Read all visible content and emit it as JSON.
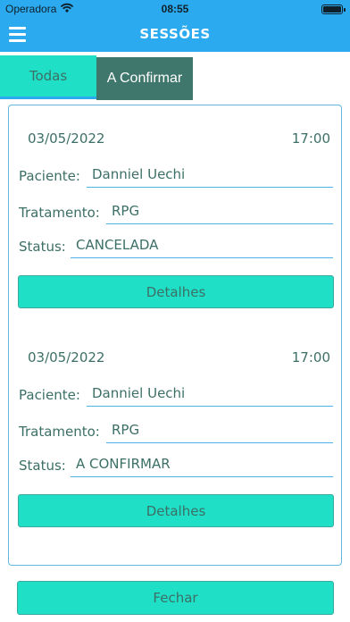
{
  "status_bar": {
    "carrier": "Operadora",
    "time": "08:55",
    "wifi_icon": "wifi-icon",
    "battery_icon": "battery-icon",
    "battery_level": 1.0
  },
  "header": {
    "title": "SESSÕES",
    "menu_icon": "menu-icon"
  },
  "tabs": [
    {
      "label": "Todas",
      "selected": true
    },
    {
      "label": "A Confirmar",
      "selected": false
    }
  ],
  "sessions": [
    {
      "date": "03/05/2022",
      "time": "17:00",
      "patient_label": "Paciente:",
      "patient": "Danniel Uechi",
      "treatment_label": "Tratamento:",
      "treatment": "RPG",
      "status_label": "Status:",
      "status": "CANCELADA",
      "details_label": "Detalhes"
    },
    {
      "date": "03/05/2022",
      "time": "17:00",
      "patient_label": "Paciente:",
      "patient": "Danniel Uechi",
      "treatment_label": "Tratamento:",
      "treatment": "RPG",
      "status_label": "Status:",
      "status": "A CONFIRMAR",
      "details_label": "Detalhes"
    }
  ],
  "footer": {
    "close_label": "Fechar"
  },
  "colors": {
    "header": "#2baaf0",
    "tab_active": "#1fe0c6",
    "tab_inactive": "#3f776c",
    "text": "#3c6f66",
    "button": "#1fe0c6"
  }
}
